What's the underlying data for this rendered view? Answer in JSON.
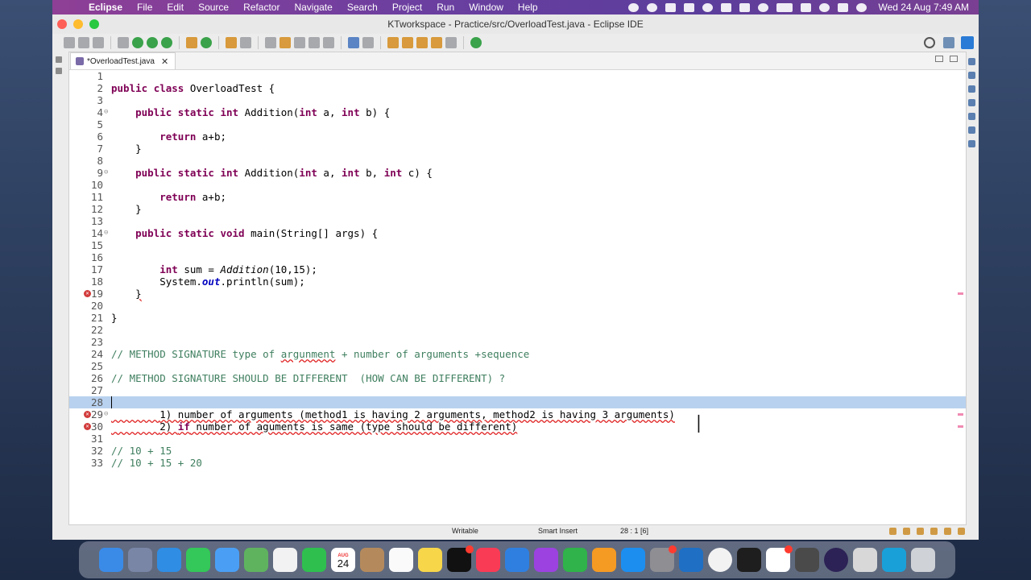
{
  "menubar": {
    "app": "Eclipse",
    "items": [
      "File",
      "Edit",
      "Source",
      "Refactor",
      "Navigate",
      "Search",
      "Project",
      "Run",
      "Window",
      "Help"
    ],
    "clock": "Wed 24 Aug  7:49 AM"
  },
  "window": {
    "title": "KTworkspace - Practice/src/OverloadTest.java - Eclipse IDE",
    "tab_label": "*OverloadTest.java"
  },
  "editor": {
    "lines": [
      {
        "n": "1",
        "text": ""
      },
      {
        "n": "2",
        "text": "public class OverloadTest {"
      },
      {
        "n": "3",
        "text": ""
      },
      {
        "n": "4",
        "text": "    public static int Addition(int a, int b) {"
      },
      {
        "n": "5",
        "text": ""
      },
      {
        "n": "6",
        "text": "        return a+b;"
      },
      {
        "n": "7",
        "text": "    }"
      },
      {
        "n": "8",
        "text": ""
      },
      {
        "n": "9",
        "text": "    public static int Addition(int a, int b, int c) {"
      },
      {
        "n": "10",
        "text": ""
      },
      {
        "n": "11",
        "text": "        return a+b;"
      },
      {
        "n": "12",
        "text": "    }"
      },
      {
        "n": "13",
        "text": ""
      },
      {
        "n": "14",
        "text": "    public static void main(String[] args) {"
      },
      {
        "n": "15",
        "text": ""
      },
      {
        "n": "16",
        "text": ""
      },
      {
        "n": "17",
        "text": "        int sum = Addition(10,15);"
      },
      {
        "n": "18",
        "text": "        System.out.println(sum);"
      },
      {
        "n": "19",
        "text": "    }"
      },
      {
        "n": "20",
        "text": ""
      },
      {
        "n": "21",
        "text": "}"
      },
      {
        "n": "22",
        "text": ""
      },
      {
        "n": "23",
        "text": ""
      },
      {
        "n": "24",
        "text": "// METHOD SIGNATURE type of argunment + number of arguments +sequence"
      },
      {
        "n": "25",
        "text": ""
      },
      {
        "n": "26",
        "text": "// METHOD SIGNATURE SHOULD BE DIFFERENT  (HOW CAN BE DIFFERENT) ?"
      },
      {
        "n": "27",
        "text": ""
      },
      {
        "n": "28",
        "text": ""
      },
      {
        "n": "29",
        "text": "        1) number of arguments (method1 is having 2 arguments, method2 is having 3 arguments)"
      },
      {
        "n": "30",
        "text": "        2) if number of aguments is same (type should be different)"
      },
      {
        "n": "31",
        "text": ""
      },
      {
        "n": "32",
        "text": "// 10 + 15"
      },
      {
        "n": "33",
        "text": "// 10 + 15 + 20"
      }
    ]
  },
  "status": {
    "writable": "Writable",
    "insert_mode": "Smart Insert",
    "position": "28 : 1 [6]"
  },
  "dock": {
    "calendar_month": "AUG",
    "calendar_day": "24",
    "apps": [
      "finder-icon",
      "launchpad-icon",
      "safari-icon",
      "messages-icon",
      "mail-icon",
      "maps-icon",
      "photos-icon",
      "facetime-icon",
      "calendar-icon",
      "contacts-icon",
      "reminders-icon",
      "notes-icon",
      "tv-icon",
      "music-icon",
      "keynote-icon",
      "podcasts-icon",
      "numbers-icon",
      "pages-icon",
      "app-store-icon",
      "system-preferences-icon",
      "vscode-icon",
      "chrome-icon",
      "terminal-icon",
      "slack-icon",
      "sublime-icon",
      "eclipse-icon",
      "preview-icon",
      "screenshot-icon",
      "trash-icon"
    ]
  }
}
